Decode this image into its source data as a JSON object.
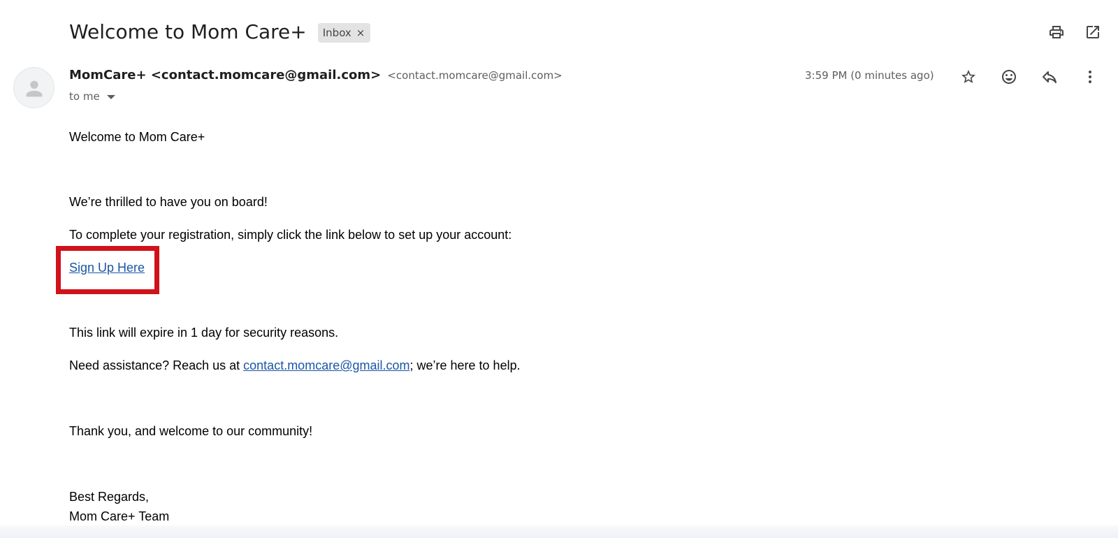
{
  "email": {
    "subject": "Welcome to Mom Care+",
    "label": "Inbox",
    "label_remove": "×",
    "sender_name": "MomCare+ <contact.momcare@gmail.com>",
    "sender_email": "<contact.momcare@gmail.com>",
    "recipient": "to me",
    "timestamp": "3:59 PM (0 minutes ago)"
  },
  "body": {
    "line1": "Welcome to Mom Care+",
    "line2": "We’re thrilled to have you on board!",
    "line3": "To complete your registration, simply click the link below to set up your account:",
    "signup_link": "Sign Up Here",
    "line4": "This link will expire in 1 day for security reasons.",
    "assist_prefix": "Need assistance? Reach us at ",
    "assist_link": "contact.momcare@gmail.com",
    "assist_suffix": "; we’re here to help.",
    "line6": "Thank you, and welcome to our community!",
    "closing": "Best Regards,",
    "signature": "Mom Care+ Team"
  },
  "icons": {
    "print": "print-icon",
    "open_new": "open-in-new-icon",
    "star": "star-icon",
    "emoji": "emoji-icon",
    "reply": "reply-icon",
    "more": "more-vert-icon"
  },
  "colors": {
    "link": "#1a56a6",
    "highlight": "#d0121a",
    "chip_bg": "#e3e3e3"
  }
}
